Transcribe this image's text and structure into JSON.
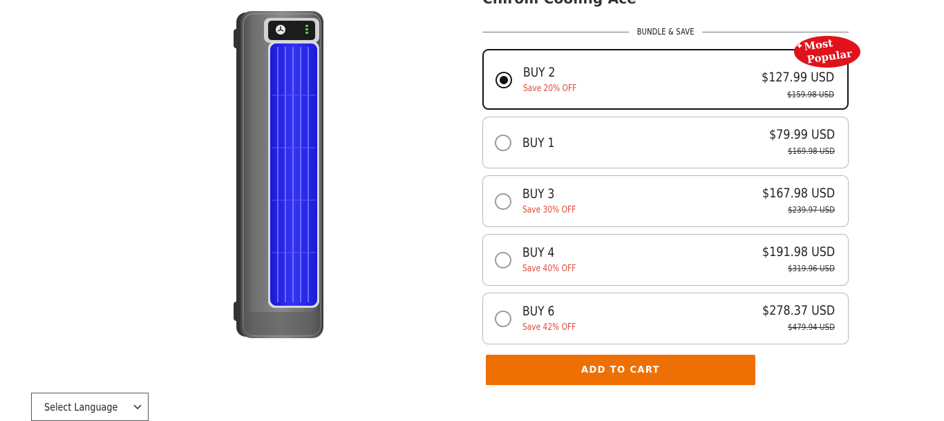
{
  "product": {
    "title": "Chirom Cooling Ace",
    "image_alt": "tower-fan-product-image"
  },
  "bundle": {
    "header": "BUNDLE & SAVE",
    "badge_line1": "Most",
    "badge_line2": "Popular",
    "options": [
      {
        "label": "BUY 2",
        "save": "Save 20% OFF",
        "price": "$127.99 USD",
        "compare": "$159.98 USD",
        "selected": true
      },
      {
        "label": "BUY 1",
        "save": "",
        "price": "$79.99 USD",
        "compare": "$169.98 USD",
        "selected": false
      },
      {
        "label": "BUY 3",
        "save": "Save 30% OFF",
        "price": "$167.98 USD",
        "compare": "$239.97 USD",
        "selected": false
      },
      {
        "label": "BUY 4",
        "save": "Save 40% OFF",
        "price": "$191.98 USD",
        "compare": "$319.96 USD",
        "selected": false
      },
      {
        "label": "BUY 6",
        "save": "Save 42% OFF",
        "price": "$278.37 USD",
        "compare": "$479.94 USD",
        "selected": false
      }
    ]
  },
  "cart": {
    "add_to_cart_label": "ADD TO CART"
  },
  "language": {
    "selected": "Select Language"
  },
  "colors": {
    "accent_orange": "#ee7005",
    "save_red": "#e04a3a",
    "badge_red": "#e0121b",
    "fan_blue": "#2b2cf0"
  },
  "icons": {
    "language_chevron": "chevron-down-icon",
    "fan_panel": "fan-icon"
  }
}
